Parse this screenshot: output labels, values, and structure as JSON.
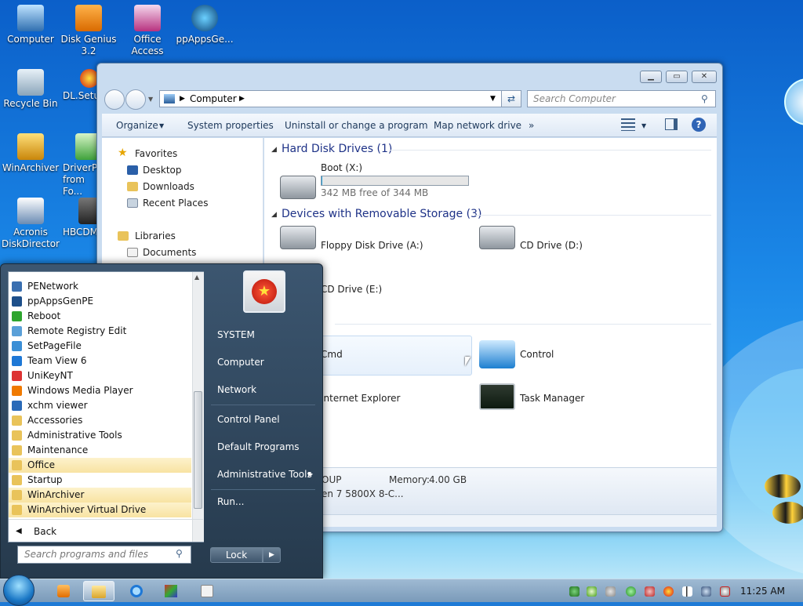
{
  "desktop": {
    "icons": [
      {
        "label": "Computer"
      },
      {
        "label": "Disk Genius 3.2"
      },
      {
        "label": "Office Access"
      },
      {
        "label": "ppAppsGe..."
      },
      {
        "label": "Recycle Bin"
      },
      {
        "label": "DL.Setup"
      },
      {
        "label": "WinArchiver"
      },
      {
        "label": "DriverPa... from Fo..."
      },
      {
        "label": "Acronis DiskDirector"
      },
      {
        "label": "HBCDM..."
      }
    ]
  },
  "explorer": {
    "address": "Computer",
    "search_placeholder": "Search Computer",
    "toolbar": [
      "Organize",
      "System properties",
      "Uninstall or change a program",
      "Map network drive",
      "»"
    ],
    "nav": {
      "favorites": "Favorites",
      "desktop": "Desktop",
      "downloads": "Downloads",
      "recent": "Recent Places",
      "libraries": "Libraries",
      "documents": "Documents"
    },
    "groups": {
      "hdd": "Hard Disk Drives (1)",
      "removable": "Devices with Removable Storage (3)",
      "other_suffix": ")"
    },
    "boot_drive": {
      "name": "Boot (X:)",
      "free_text": "342 MB free of 344 MB",
      "used_fraction": 0.006
    },
    "devices": [
      "Floppy Disk Drive (A:)",
      "CD Drive (D:)",
      "CD Drive (E:)"
    ],
    "other_items": [
      "Cmd",
      "Control",
      "Internet Explorer",
      "Task Manager"
    ],
    "details": {
      "workgroup": "OUP",
      "memory_label": "Memory:",
      "memory_value": "4.00 GB",
      "processor": "en 7 5800X 8-C..."
    }
  },
  "start_menu": {
    "programs": [
      {
        "label": "PENetwork",
        "icon": "network-icon"
      },
      {
        "label": "ppAppsGenPE",
        "icon": "app-icon"
      },
      {
        "label": "Reboot",
        "icon": "reboot-icon"
      },
      {
        "label": "Remote Registry Edit",
        "icon": "registry-icon"
      },
      {
        "label": "SetPageFile",
        "icon": "pagefile-icon"
      },
      {
        "label": "Team View 6",
        "icon": "teamviewer-icon"
      },
      {
        "label": "UniKeyNT",
        "icon": "unikey-icon"
      },
      {
        "label": "Windows Media Player",
        "icon": "media-player-icon"
      },
      {
        "label": "xchm viewer",
        "icon": "chm-icon"
      },
      {
        "label": "Accessories",
        "icon": "folder-icon"
      },
      {
        "label": "Administrative Tools",
        "icon": "folder-icon"
      },
      {
        "label": "Maintenance",
        "icon": "folder-icon"
      },
      {
        "label": "Office",
        "icon": "folder-icon"
      },
      {
        "label": "Startup",
        "icon": "folder-icon"
      },
      {
        "label": "WinArchiver",
        "icon": "folder-icon"
      },
      {
        "label": "WinArchiver Virtual Drive",
        "icon": "folder-icon"
      }
    ],
    "back_label": "Back",
    "search_placeholder": "Search programs and files",
    "right": [
      "SYSTEM",
      "Computer",
      "Network",
      "Control Panel",
      "Default Programs",
      "Administrative Tools",
      "Run..."
    ],
    "lock_label": "Lock"
  },
  "taskbar": {
    "clock": "11:25 AM"
  }
}
